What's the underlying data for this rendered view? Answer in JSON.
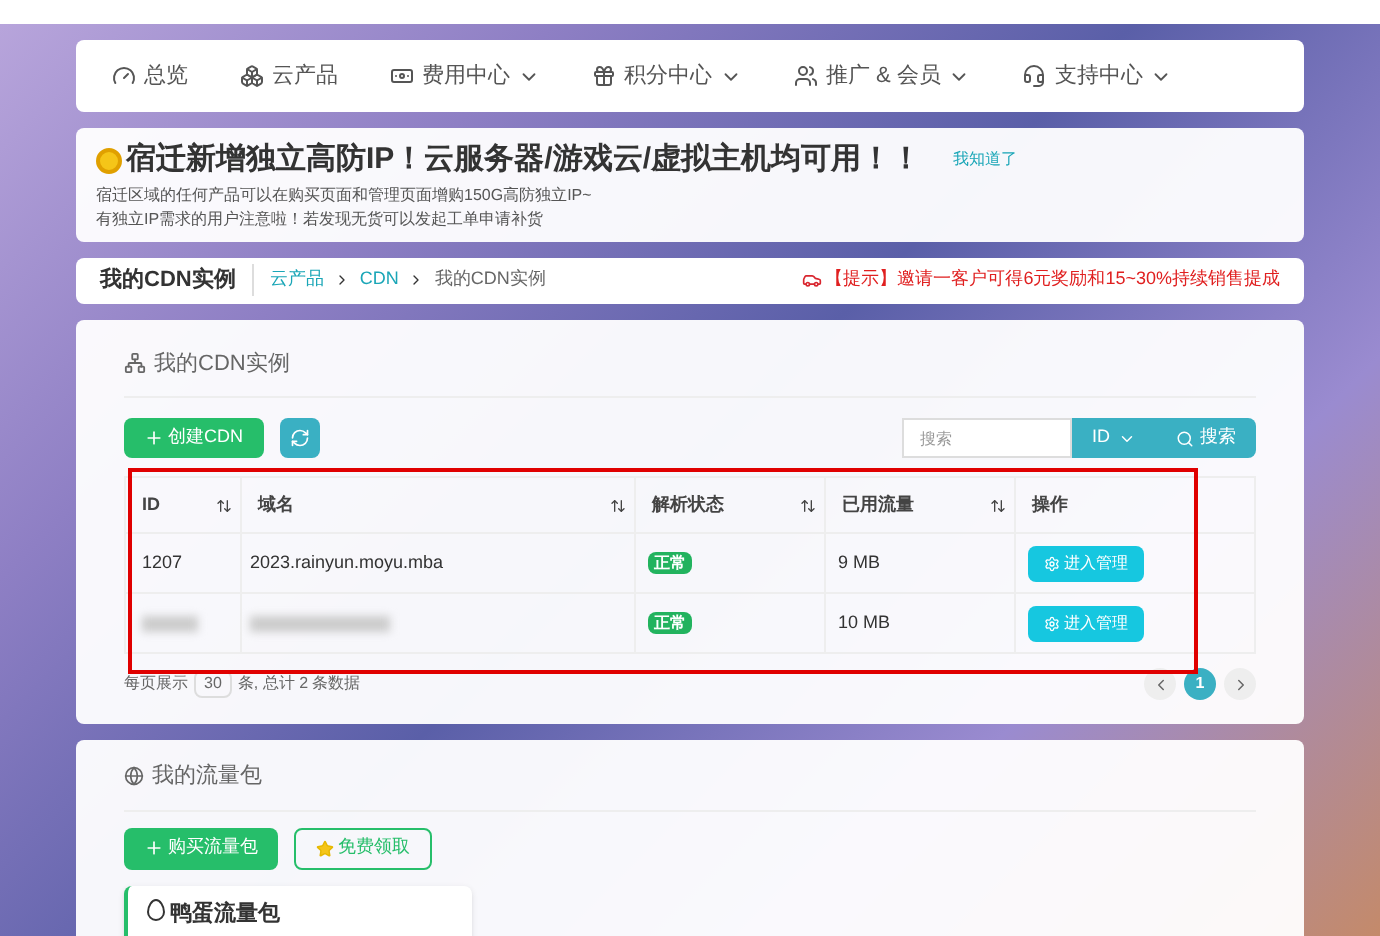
{
  "nav": {
    "items": [
      {
        "label": "总览",
        "dropdown": false
      },
      {
        "label": "云产品",
        "dropdown": false
      },
      {
        "label": "费用中心",
        "dropdown": true
      },
      {
        "label": "积分中心",
        "dropdown": true
      },
      {
        "label": "推广 & 会员",
        "dropdown": true
      },
      {
        "label": "支持中心",
        "dropdown": true
      }
    ]
  },
  "notice": {
    "title": "宿迁新增独立高防IP！云服务器/游戏云/虚拟主机均可用！！",
    "dismiss": "我知道了",
    "lines": [
      "宿迁区域的任何产品可以在购买页面和管理页面增购150G高防独立IP~",
      "有独立IP需求的用户注意啦！若发现无货可以发起工单申请补货"
    ]
  },
  "breadcrumb": {
    "page_title": "我的CDN实例",
    "items": [
      "云产品",
      "CDN",
      "我的CDN实例"
    ],
    "tip": "【提示】邀请一客户可得6元奖励和15~30%持续销售提成"
  },
  "cdn_card": {
    "title": "我的CDN实例",
    "create_button": "创建CDN",
    "search": {
      "placeholder": "搜索",
      "field_select": "ID",
      "button": "搜索"
    },
    "table": {
      "columns": [
        {
          "label": "ID",
          "sortable": true
        },
        {
          "label": "域名",
          "sortable": true
        },
        {
          "label": "解析状态",
          "sortable": true
        },
        {
          "label": "已用流量",
          "sortable": true
        },
        {
          "label": "操作",
          "sortable": false
        }
      ],
      "rows": [
        {
          "id": "1207",
          "domain": "2023.rainyun.moyu.mba",
          "blurred": false,
          "status": "正常",
          "traffic": "9 MB",
          "action": "进入管理"
        },
        {
          "blurred": true,
          "status": "正常",
          "traffic": "10 MB",
          "action": "进入管理"
        }
      ]
    },
    "pagination": {
      "per_page_label": "每页展示",
      "per_page": "30",
      "total": "条, 总计 2 条数据",
      "pages": [
        {
          "label": "1",
          "selected": true
        }
      ]
    }
  },
  "traffic_card": {
    "title": "我的流量包",
    "buy_button": "购买流量包",
    "free_button": "免费领取",
    "package": {
      "title": "鸭蛋流量包"
    }
  },
  "highlight": {
    "shown": true
  }
}
